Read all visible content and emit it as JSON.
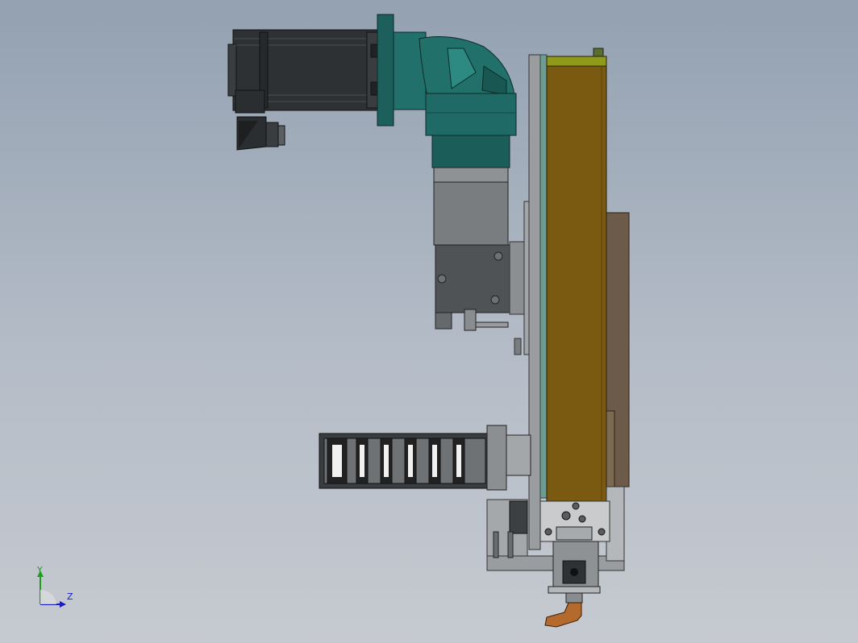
{
  "view": {
    "background_top": "#93a1b1",
    "background_bottom": "#c6cad0"
  },
  "colors": {
    "motor_body": "#2c2f30",
    "gearbox_teal": "#1f6a66",
    "actuator_body": "#7a5a10",
    "actuator_highlight": "#9b7a1a",
    "steel_gray": "#8b8e91",
    "dark_steel": "#3d4043",
    "bracket_brown": "#6b5b48",
    "nozzle_orange": "#b46a2c",
    "outline": "#1a1a1a"
  },
  "components": [
    {
      "name": "servo-motor",
      "icon": "motor-icon"
    },
    {
      "name": "motor-connector",
      "icon": "connector-icon"
    },
    {
      "name": "right-angle-gearbox",
      "icon": "gearbox-icon"
    },
    {
      "name": "coupling-housing",
      "icon": "coupling-icon"
    },
    {
      "name": "linear-actuator",
      "icon": "actuator-icon"
    },
    {
      "name": "cable-drag-chain",
      "icon": "chain-icon"
    },
    {
      "name": "tool-head",
      "icon": "tool-icon"
    },
    {
      "name": "nozzle-tip",
      "icon": "nozzle-icon"
    }
  ],
  "axis_triad": {
    "y_label": "Y",
    "z_label": "Z",
    "y_color": "#1aa01a",
    "z_color": "#1a1ac8"
  }
}
